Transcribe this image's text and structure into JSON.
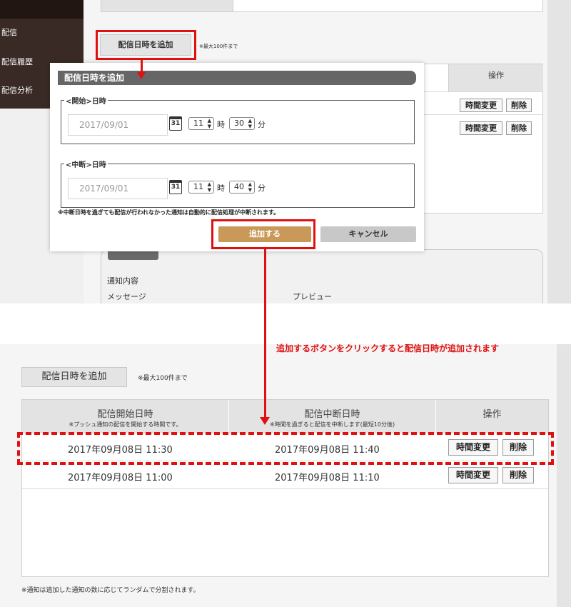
{
  "top": {
    "sidebar": {
      "items": [
        "配信",
        "配信履歴",
        "配信分析"
      ]
    },
    "add_button_label": "配信日時を追加",
    "max_note": "※最大100件まで",
    "ops_header": "操作",
    "rows": [
      {
        "change_label": "時間変更",
        "delete_label": "削除"
      },
      {
        "change_label": "時間変更",
        "delete_label": "削除"
      }
    ],
    "notice_content_label": "通知内容",
    "message_label": "メッセージ",
    "preview_label": "プレビュー"
  },
  "modal": {
    "title": "配信日時を追加",
    "start": {
      "legend": "<開始>日時",
      "date": "2017/09/01",
      "calendar_day": "31",
      "hour": "11",
      "hour_unit": "時",
      "minute": "30",
      "minute_unit": "分"
    },
    "stop": {
      "legend": "<中断>日時",
      "date": "2017/09/01",
      "calendar_day": "31",
      "hour": "11",
      "hour_unit": "時",
      "minute": "40",
      "minute_unit": "分"
    },
    "note": "※中断日時を過ぎても配信が行われなかった通知は自動的に配信処理が中断されます。",
    "add_label": "追加する",
    "cancel_label": "キャンセル"
  },
  "annotation": "追加するボタンをクリックすると配信日時が追加されます",
  "bottom": {
    "add_button_label": "配信日時を追加",
    "max_note": "※最大100件まで",
    "headers": {
      "start": {
        "title": "配信開始日時",
        "sub": "※プッシュ通知の配信を開始する時間です。"
      },
      "stop": {
        "title": "配信中断日時",
        "sub": "※時間を過ぎると配信を中断します(最短10分後)"
      },
      "ops": {
        "title": "操作"
      }
    },
    "rows": [
      {
        "start": "2017年09月08日 11:30",
        "stop": "2017年09月08日 11:40",
        "change_label": "時間変更",
        "delete_label": "削除"
      },
      {
        "start": "2017年09月08日 11:00",
        "stop": "2017年09月08日 11:10",
        "change_label": "時間変更",
        "delete_label": "削除"
      }
    ],
    "footer_note": "※通知は追加した通知の数に応じてランダムで分割されます。"
  },
  "colors": {
    "highlight_red": "#e01010",
    "add_button_gold": "#c9995a",
    "sidebar_dark": "#3a2a25"
  }
}
